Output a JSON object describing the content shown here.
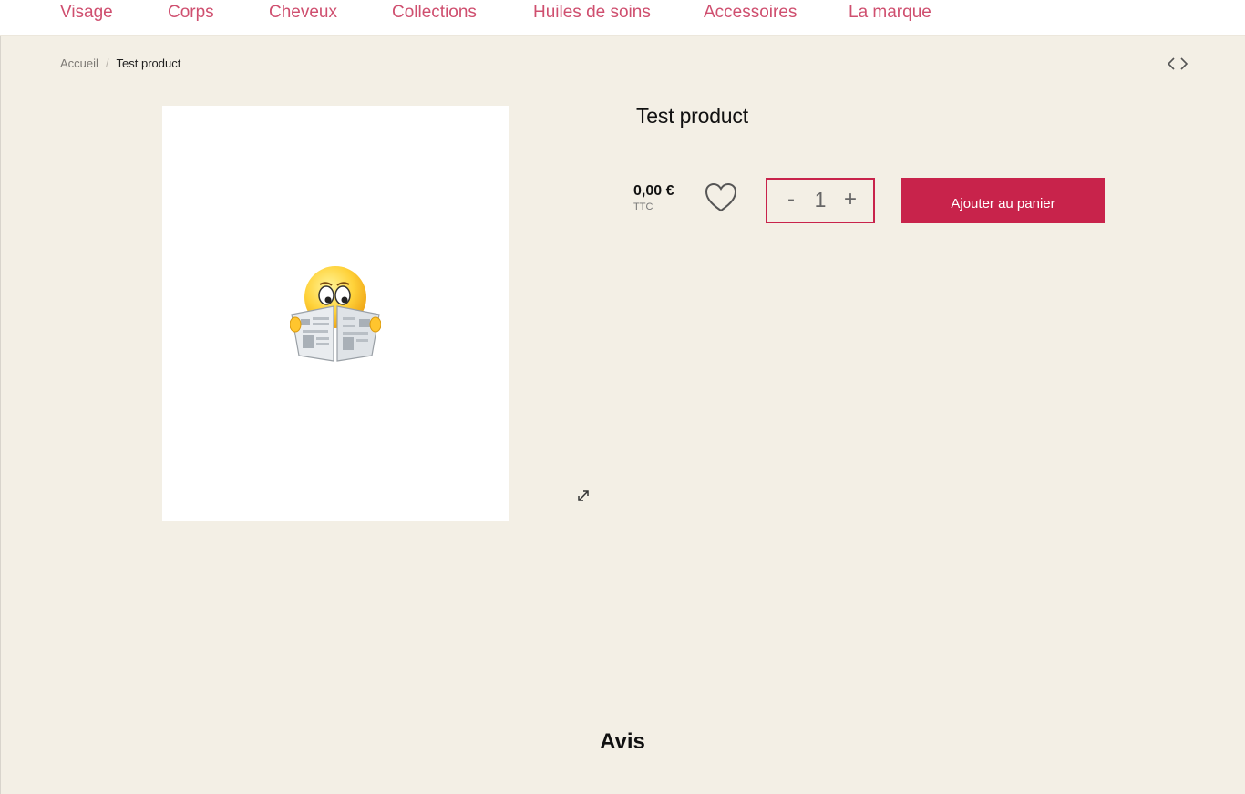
{
  "nav": {
    "items": [
      {
        "label": "Visage"
      },
      {
        "label": "Corps"
      },
      {
        "label": "Cheveux"
      },
      {
        "label": "Collections"
      },
      {
        "label": "Huiles de soins"
      },
      {
        "label": "Accessoires"
      },
      {
        "label": "La marque"
      }
    ]
  },
  "breadcrumb": {
    "home": "Accueil",
    "separator": "/",
    "current": "Test product"
  },
  "product": {
    "title": "Test product",
    "price": "0,00 €",
    "tax_label": "TTC",
    "quantity": {
      "minus_label": "-",
      "value": "1",
      "plus_label": "+"
    },
    "add_to_cart_label": "Ajouter au panier"
  },
  "reviews": {
    "heading": "Avis"
  },
  "icons": {
    "pager_prev": "chevron-left-icon",
    "pager_next": "chevron-right-icon",
    "wishlist": "heart-icon",
    "zoom": "expand-icon",
    "product_illustration": "emoji-reading-newspaper"
  },
  "colors": {
    "accent": "#c8234b",
    "nav_text": "#cf4f6f",
    "background": "#f3efe5"
  }
}
